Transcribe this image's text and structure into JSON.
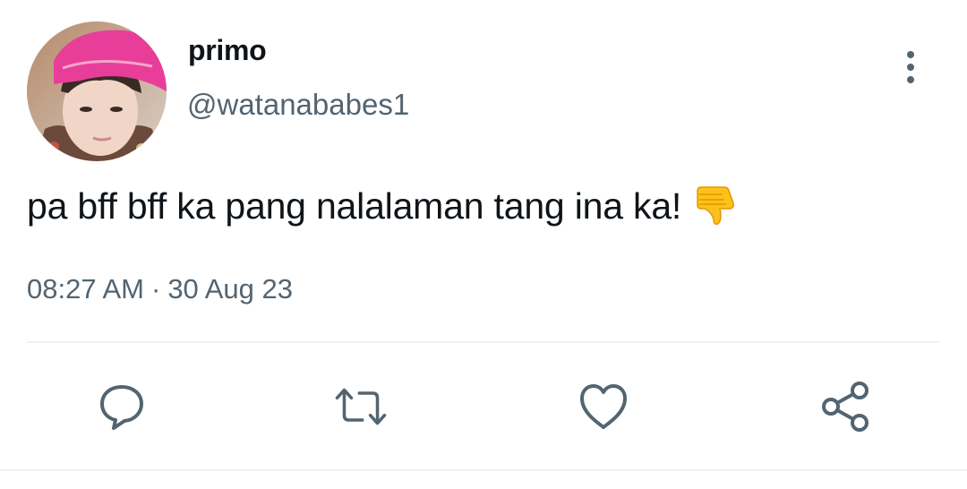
{
  "tweet": {
    "display_name": "primo",
    "username": "@watanababes1",
    "text": "pa bff bff ka pang nalalaman tang ina ka!",
    "emoji": "thumbs-down-emoji",
    "time": "08:27 AM",
    "separator": "·",
    "date": "30 Aug 23"
  },
  "actions": [
    {
      "icon": "reply-icon"
    },
    {
      "icon": "retweet-icon"
    },
    {
      "icon": "like-icon"
    },
    {
      "icon": "share-icon"
    }
  ],
  "colors": {
    "text_primary": "#0f1419",
    "text_secondary": "#536471",
    "divider": "#eff3f4",
    "icon": "#536471",
    "avatar_cap": "#e83e9a"
  }
}
